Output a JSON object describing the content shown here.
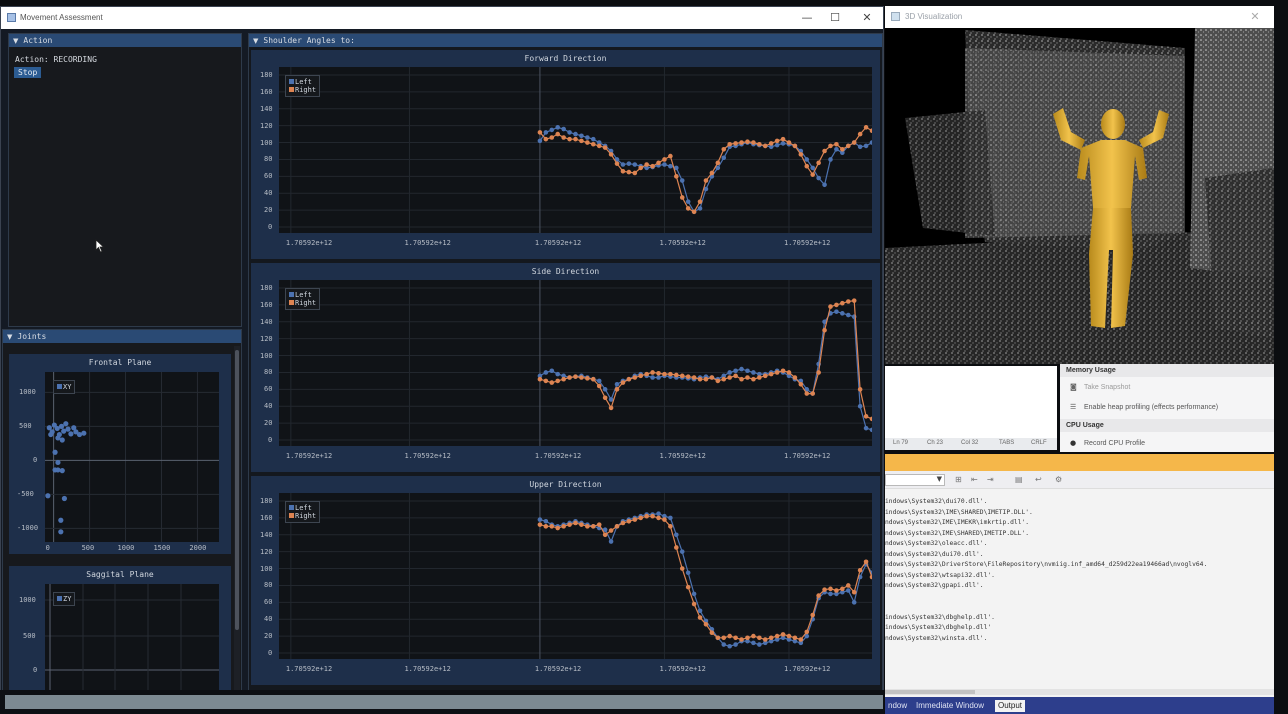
{
  "main_window": {
    "title": "Movement Assessment",
    "controls": {
      "minimize": "—",
      "maximize": "☐",
      "close": "✕"
    }
  },
  "action_panel": {
    "header": "Action",
    "status": "Action: RECORDING",
    "stop_label": "Stop"
  },
  "joints_panel": {
    "header": "Joints",
    "frontal": {
      "title": "Frontal Plane",
      "legend": "XY",
      "x_ticks": [
        "0",
        "500",
        "1000",
        "1500",
        "2000"
      ],
      "y_ticks": [
        "1000",
        "500",
        "0",
        "-500",
        "-1000"
      ],
      "points": [
        [
          -60,
          480
        ],
        [
          -20,
          420
        ],
        [
          10,
          520
        ],
        [
          50,
          470
        ],
        [
          80,
          380
        ],
        [
          110,
          500
        ],
        [
          140,
          430
        ],
        [
          170,
          540
        ],
        [
          200,
          460
        ],
        [
          240,
          390
        ],
        [
          280,
          480
        ],
        [
          310,
          420
        ],
        [
          360,
          380
        ],
        [
          420,
          400
        ],
        [
          -40,
          380
        ],
        [
          60,
          330
        ],
        [
          120,
          300
        ],
        [
          20,
          120
        ],
        [
          60,
          -30
        ],
        [
          20,
          -140
        ],
        [
          60,
          -140
        ],
        [
          120,
          -150
        ],
        [
          -80,
          -520
        ],
        [
          150,
          -560
        ],
        [
          100,
          -880
        ],
        [
          100,
          -1050
        ]
      ],
      "xlim": [
        -120,
        2300
      ],
      "ylim": [
        -1200,
        1300
      ]
    },
    "sagittal": {
      "title": "Saggital Plane",
      "legend": "ZY",
      "y_ticks": [
        "1000",
        "500",
        "0"
      ]
    }
  },
  "shoulder_panel": {
    "header": "Shoulder Angles to:",
    "x_tick_label": "1.70592e+12",
    "legend": {
      "left": "Left",
      "right": "Right"
    },
    "colors": {
      "left": "#4c72b0",
      "right": "#dd8452"
    }
  },
  "chart_data": [
    {
      "type": "line",
      "title": "Forward Direction",
      "ylim": [
        0,
        180
      ],
      "y_ticks": [
        0,
        20,
        40,
        60,
        80,
        100,
        120,
        140,
        160,
        180
      ],
      "xlim": [
        0,
        100
      ],
      "grid": true,
      "legend_position": "top-left",
      "series": [
        {
          "name": "Left",
          "x": [
            44,
            45,
            46,
            47,
            48,
            49,
            50,
            51,
            52,
            53,
            54,
            55,
            56,
            57,
            58,
            59,
            60,
            61,
            62,
            63,
            64,
            65,
            66,
            67,
            68,
            69,
            70,
            71,
            72,
            73,
            74,
            75,
            76,
            77,
            78,
            79,
            80,
            81,
            82,
            83,
            84,
            85,
            86,
            87,
            88,
            89,
            90,
            91,
            92,
            93,
            94,
            95,
            96,
            97,
            98,
            99,
            100
          ],
          "values": [
            102,
            112,
            115,
            118,
            116,
            112,
            110,
            108,
            106,
            104,
            100,
            96,
            90,
            80,
            74,
            75,
            74,
            72,
            70,
            71,
            73,
            74,
            72,
            70,
            55,
            30,
            18,
            22,
            45,
            60,
            70,
            82,
            95,
            96,
            98,
            100,
            98,
            97,
            96,
            95,
            97,
            99,
            98,
            96,
            90,
            80,
            70,
            58,
            50,
            80,
            92,
            88,
            96,
            100,
            95,
            96,
            100
          ]
        },
        {
          "name": "Right",
          "x": [
            44,
            45,
            46,
            47,
            48,
            49,
            50,
            51,
            52,
            53,
            54,
            55,
            56,
            57,
            58,
            59,
            60,
            61,
            62,
            63,
            64,
            65,
            66,
            67,
            68,
            69,
            70,
            71,
            72,
            73,
            74,
            75,
            76,
            77,
            78,
            79,
            80,
            81,
            82,
            83,
            84,
            85,
            86,
            87,
            88,
            89,
            90,
            91,
            92,
            93,
            94,
            95,
            96,
            97,
            98,
            99,
            100
          ],
          "values": [
            112,
            104,
            106,
            110,
            106,
            104,
            104,
            102,
            100,
            98,
            96,
            94,
            86,
            75,
            66,
            65,
            64,
            70,
            74,
            72,
            76,
            80,
            84,
            60,
            35,
            22,
            18,
            30,
            55,
            64,
            76,
            92,
            98,
            99,
            100,
            101,
            100,
            98,
            96,
            99,
            102,
            104,
            100,
            96,
            86,
            72,
            62,
            76,
            90,
            96,
            98,
            92,
            96,
            100,
            110,
            118,
            114
          ]
        }
      ]
    },
    {
      "type": "line",
      "title": "Side Direction",
      "ylim": [
        0,
        180
      ],
      "y_ticks": [
        0,
        20,
        40,
        60,
        80,
        100,
        120,
        140,
        160,
        180
      ],
      "xlim": [
        0,
        100
      ],
      "grid": true,
      "legend_position": "top-left",
      "series": [
        {
          "name": "Left",
          "x": [
            44,
            45,
            46,
            47,
            48,
            49,
            50,
            51,
            52,
            53,
            54,
            55,
            56,
            57,
            58,
            59,
            60,
            61,
            62,
            63,
            64,
            65,
            66,
            67,
            68,
            69,
            70,
            71,
            72,
            73,
            74,
            75,
            76,
            77,
            78,
            79,
            80,
            81,
            82,
            83,
            84,
            85,
            86,
            87,
            88,
            89,
            90,
            91,
            92,
            93,
            94,
            95,
            96,
            97,
            98,
            99,
            100
          ],
          "values": [
            76,
            80,
            82,
            78,
            76,
            74,
            75,
            76,
            74,
            72,
            70,
            60,
            48,
            66,
            70,
            72,
            76,
            78,
            76,
            74,
            74,
            76,
            75,
            74,
            74,
            73,
            72,
            74,
            75,
            74,
            72,
            76,
            80,
            82,
            84,
            82,
            80,
            78,
            78,
            80,
            82,
            80,
            76,
            72,
            70,
            60,
            55,
            90,
            140,
            150,
            152,
            150,
            148,
            146,
            40,
            14,
            12
          ]
        },
        {
          "name": "Right",
          "x": [
            44,
            45,
            46,
            47,
            48,
            49,
            50,
            51,
            52,
            53,
            54,
            55,
            56,
            57,
            58,
            59,
            60,
            61,
            62,
            63,
            64,
            65,
            66,
            67,
            68,
            69,
            70,
            71,
            72,
            73,
            74,
            75,
            76,
            77,
            78,
            79,
            80,
            81,
            82,
            83,
            84,
            85,
            86,
            87,
            88,
            89,
            90,
            91,
            92,
            93,
            94,
            95,
            96,
            97,
            98,
            99,
            100
          ],
          "values": [
            72,
            70,
            68,
            70,
            72,
            74,
            75,
            74,
            73,
            72,
            64,
            50,
            38,
            60,
            68,
            72,
            74,
            76,
            78,
            80,
            79,
            78,
            78,
            77,
            76,
            75,
            74,
            72,
            72,
            74,
            70,
            72,
            74,
            76,
            72,
            74,
            72,
            74,
            76,
            78,
            80,
            82,
            80,
            74,
            66,
            55,
            55,
            80,
            130,
            158,
            160,
            162,
            164,
            165,
            60,
            28,
            25
          ]
        }
      ]
    },
    {
      "type": "line",
      "title": "Upper Direction",
      "ylim": [
        0,
        180
      ],
      "y_ticks": [
        0,
        20,
        40,
        60,
        80,
        100,
        120,
        140,
        160,
        180
      ],
      "xlim": [
        0,
        100
      ],
      "grid": true,
      "legend_position": "top-left",
      "series": [
        {
          "name": "Left",
          "x": [
            44,
            45,
            46,
            47,
            48,
            49,
            50,
            51,
            52,
            53,
            54,
            55,
            56,
            57,
            58,
            59,
            60,
            61,
            62,
            63,
            64,
            65,
            66,
            67,
            68,
            69,
            70,
            71,
            72,
            73,
            74,
            75,
            76,
            77,
            78,
            79,
            80,
            81,
            82,
            83,
            84,
            85,
            86,
            87,
            88,
            89,
            90,
            91,
            92,
            93,
            94,
            95,
            96,
            97,
            98,
            99,
            100
          ],
          "values": [
            158,
            156,
            152,
            150,
            152,
            154,
            156,
            154,
            152,
            150,
            148,
            146,
            132,
            150,
            156,
            158,
            160,
            162,
            164,
            164,
            165,
            162,
            160,
            140,
            120,
            95,
            70,
            50,
            38,
            28,
            18,
            10,
            8,
            10,
            14,
            14,
            12,
            10,
            12,
            14,
            16,
            18,
            16,
            14,
            12,
            20,
            40,
            65,
            72,
            70,
            70,
            72,
            74,
            60,
            90,
            105,
            95
          ]
        },
        {
          "name": "Right",
          "x": [
            44,
            45,
            46,
            47,
            48,
            49,
            50,
            51,
            52,
            53,
            54,
            55,
            56,
            57,
            58,
            59,
            60,
            61,
            62,
            63,
            64,
            65,
            66,
            67,
            68,
            69,
            70,
            71,
            72,
            73,
            74,
            75,
            76,
            77,
            78,
            79,
            80,
            81,
            82,
            83,
            84,
            85,
            86,
            87,
            88,
            89,
            90,
            91,
            92,
            93,
            94,
            95,
            96,
            97,
            98,
            99,
            100
          ],
          "values": [
            152,
            150,
            150,
            148,
            150,
            152,
            154,
            152,
            150,
            150,
            152,
            140,
            145,
            150,
            154,
            156,
            158,
            160,
            162,
            162,
            160,
            158,
            150,
            125,
            100,
            78,
            58,
            42,
            34,
            24,
            18,
            18,
            20,
            18,
            16,
            18,
            20,
            18,
            16,
            18,
            20,
            22,
            20,
            18,
            16,
            25,
            45,
            68,
            75,
            76,
            74,
            76,
            80,
            72,
            98,
            108,
            90
          ]
        }
      ]
    }
  ],
  "viz_window": {
    "title": "3D Visualization",
    "close": "✕"
  },
  "ide": {
    "status": {
      "ln": "Ln 79",
      "ch": "Ch 23",
      "col": "Col 32",
      "tabs": "TABS",
      "crlf": "CRLF"
    },
    "memory_header": "Memory Usage",
    "take_snapshot": "Take Snapshot",
    "enable_heap": "Enable heap profiling (effects performance)",
    "cpu_header": "CPU Usage",
    "record_cpu": "Record CPU Profile",
    "output_lines": [
      "indows\\System32\\dui70.dll'.",
      "indows\\System32\\IME\\SHARED\\IMETIP.DLL'.",
      "ndows\\System32\\IME\\IMEKR\\imkrtip.dll'.",
      "ndows\\System32\\IME\\SHARED\\IMETIP.DLL'.",
      "ndows\\System32\\oleacc.dll'.",
      "ndows\\System32\\dui70.dll'.",
      "ndows\\System32\\DriverStore\\FileRepository\\nvmiig.inf_amd64_d259d22ea19466ad\\nvoglv64.",
      "ndows\\System32\\wtsapi32.dll'.",
      "ndows\\System32\\gpapi.dll'.",
      "",
      "",
      "indows\\System32\\dbghelp.dll'.",
      "indows\\System32\\dbghelp.dll'",
      "ndows\\System32\\winsta.dll'."
    ],
    "tabs": [
      "ndow",
      "Immediate Window",
      "Output"
    ]
  }
}
